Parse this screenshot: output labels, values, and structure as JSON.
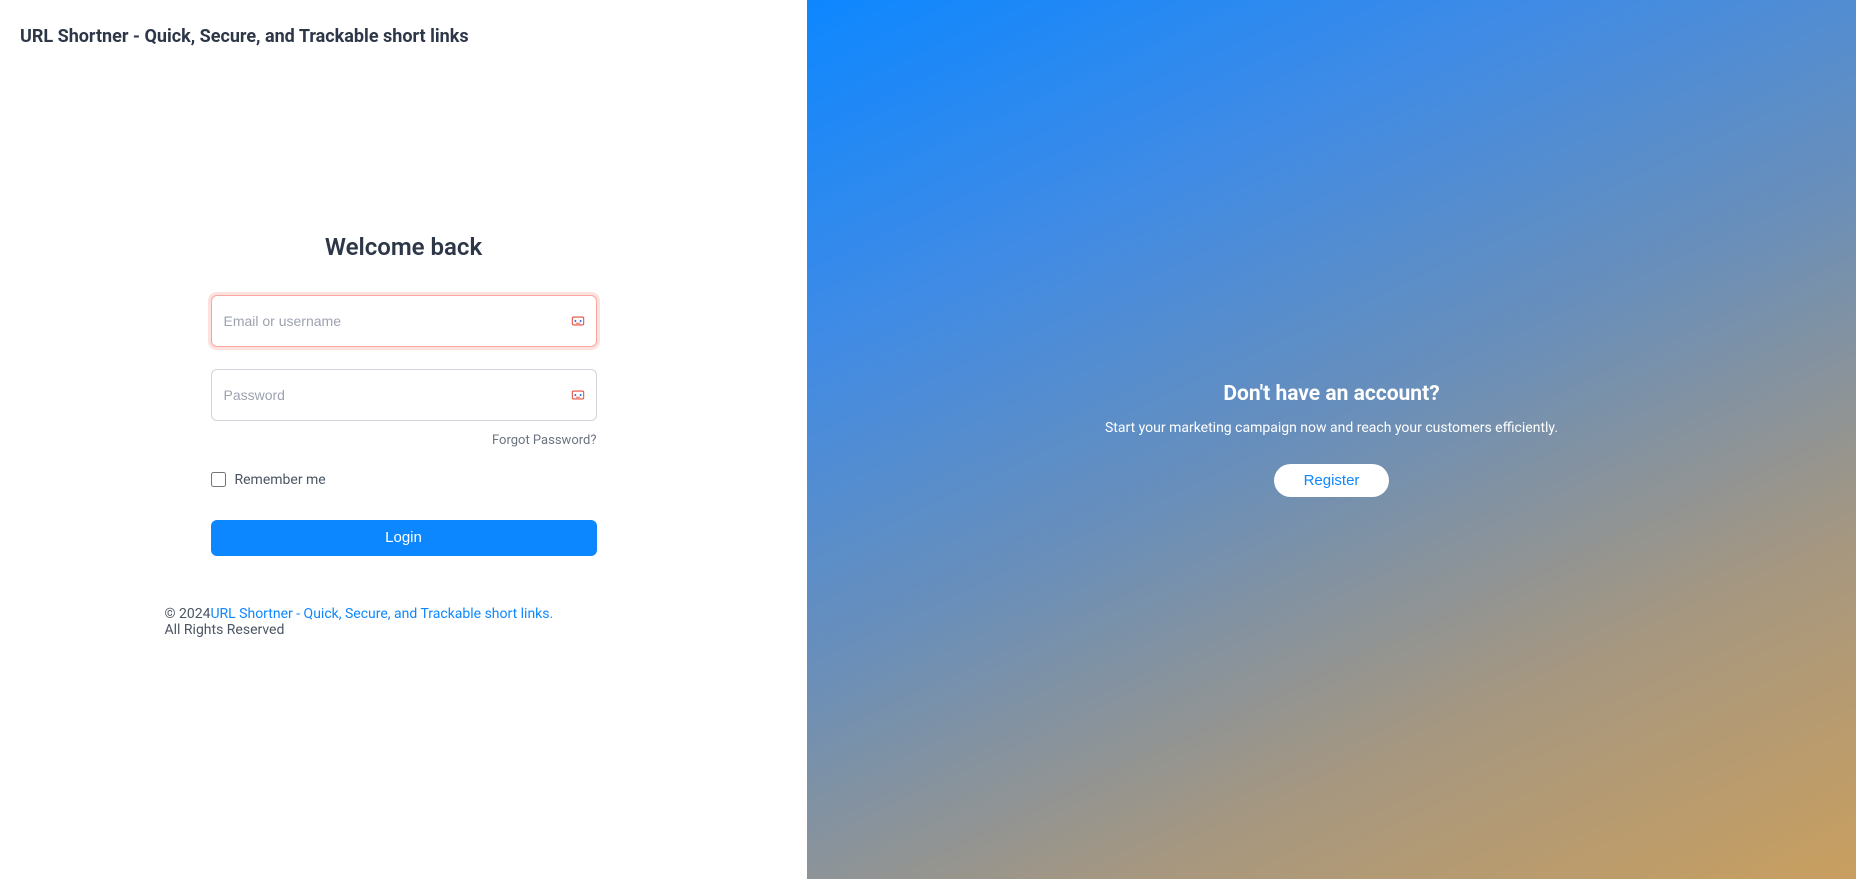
{
  "app": {
    "title": "URL Shortner - Quick, Secure, and Trackable short links"
  },
  "login": {
    "welcome_title": "Welcome back",
    "email_placeholder": "Email or username",
    "password_placeholder": "Password",
    "forgot_password": "Forgot Password?",
    "remember_me": "Remember me",
    "login_button": "Login"
  },
  "footer": {
    "copyright_prefix": "© 2024 ",
    "link_text": "URL Shortner - Quick, Secure, and Trackable short links.",
    "copyright_suffix": " All Rights Reserved"
  },
  "right": {
    "title": "Don't have an account?",
    "subtitle": "Start your marketing campaign now and reach your customers efficiently.",
    "register_button": "Register"
  }
}
